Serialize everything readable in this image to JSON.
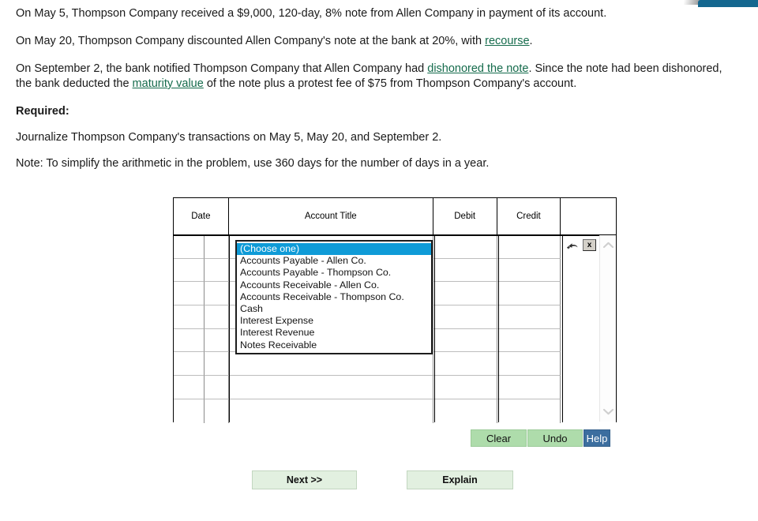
{
  "problem": {
    "paragraphs": [
      {
        "id": "p1",
        "runs": [
          {
            "t": "On May 5, Thompson Company received a $9,000, 120-day, 8% note from Allen Company in payment of its account."
          }
        ]
      },
      {
        "id": "p2",
        "runs": [
          {
            "t": "On May 20, Thompson Company discounted Allen Company's note at the bank at 20%, with "
          },
          {
            "t": "recourse",
            "link": true
          },
          {
            "t": "."
          }
        ]
      },
      {
        "id": "p3",
        "runs": [
          {
            "t": "On September 2, the bank notified Thompson Company that Allen Company had "
          },
          {
            "t": "dishonored the note",
            "link": true
          },
          {
            "t": ". Since the note had been dishonored, the bank deducted the "
          },
          {
            "t": "maturity value",
            "link": true
          },
          {
            "t": " of the note plus a protest fee of $75 from Thompson Company's account."
          }
        ]
      }
    ],
    "required_heading": "Required:",
    "required_text": "Journalize Thompson Company's transactions on May 5, May 20, and September 2.",
    "note_text": "Note: To simplify the arithmetic in the problem, use 360 days for the number of days in a year."
  },
  "journal": {
    "headers": {
      "date": "Date",
      "account_title": "Account Title",
      "debit": "Debit",
      "credit": "Credit",
      "tools": ""
    },
    "rows": [
      {
        "date": "",
        "date2": "",
        "account": "",
        "debit": "",
        "credit": ""
      },
      {
        "date": "",
        "date2": "",
        "account": "",
        "debit": "",
        "credit": ""
      },
      {
        "date": "",
        "date2": "",
        "account": "",
        "debit": "",
        "credit": ""
      },
      {
        "date": "",
        "date2": "",
        "account": "",
        "debit": "",
        "credit": ""
      },
      {
        "date": "",
        "date2": "",
        "account": "",
        "debit": "",
        "credit": ""
      },
      {
        "date": "",
        "date2": "",
        "account": "",
        "debit": "",
        "credit": ""
      },
      {
        "date": "",
        "date2": "",
        "account": "",
        "debit": "",
        "credit": ""
      },
      {
        "date": "",
        "date2": "",
        "account": "",
        "debit": "",
        "credit": ""
      }
    ],
    "row_tools": {
      "insert_icon": "undo-arrow-icon",
      "delete_label": "x"
    },
    "scrollbar": {
      "up_icon": "chevron-up-icon",
      "down_icon": "chevron-down-icon"
    }
  },
  "dropdown": {
    "open": true,
    "selected_index": 0,
    "options": [
      "(Choose one)",
      "Accounts Payable - Allen Co.",
      "Accounts Payable - Thompson Co.",
      "Accounts Receivable - Allen Co.",
      "Accounts Receivable - Thompson Co.",
      "Cash",
      "Interest Expense",
      "Interest Revenue",
      "Notes Receivable"
    ]
  },
  "actions": {
    "clear": "Clear",
    "undo": "Undo",
    "help": "Help",
    "next": "Next >>",
    "explain": "Explain"
  },
  "colors": {
    "link": "#156b4c",
    "selection_blue": "#0f9bd7",
    "help_blue": "#3c6e9f",
    "small_button_green": "#aedcab",
    "large_button_green": "#e2f0e0",
    "tab_blue": "#14678f"
  }
}
